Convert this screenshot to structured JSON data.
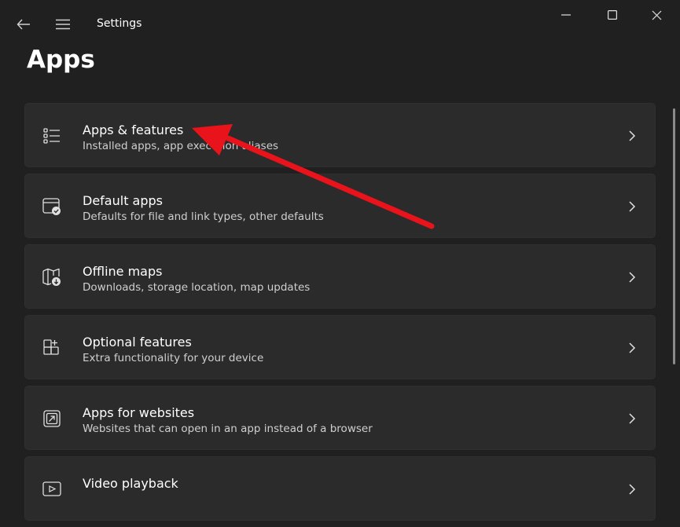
{
  "window": {
    "title": "Settings"
  },
  "page": {
    "title": "Apps"
  },
  "items": [
    {
      "title": "Apps & features",
      "description": "Installed apps, app execution aliases",
      "icon": "apps-list-icon"
    },
    {
      "title": "Default apps",
      "description": "Defaults for file and link types, other defaults",
      "icon": "default-apps-icon"
    },
    {
      "title": "Offline maps",
      "description": "Downloads, storage location, map updates",
      "icon": "map-download-icon"
    },
    {
      "title": "Optional features",
      "description": "Extra functionality for your device",
      "icon": "optional-features-icon"
    },
    {
      "title": "Apps for websites",
      "description": "Websites that can open in an app instead of a browser",
      "icon": "open-in-app-icon"
    },
    {
      "title": "Video playback",
      "description": "",
      "icon": "video-playback-icon"
    }
  ],
  "colors": {
    "background": "#202020",
    "card": "#2b2b2b",
    "annotation_arrow": "#e8131b"
  }
}
